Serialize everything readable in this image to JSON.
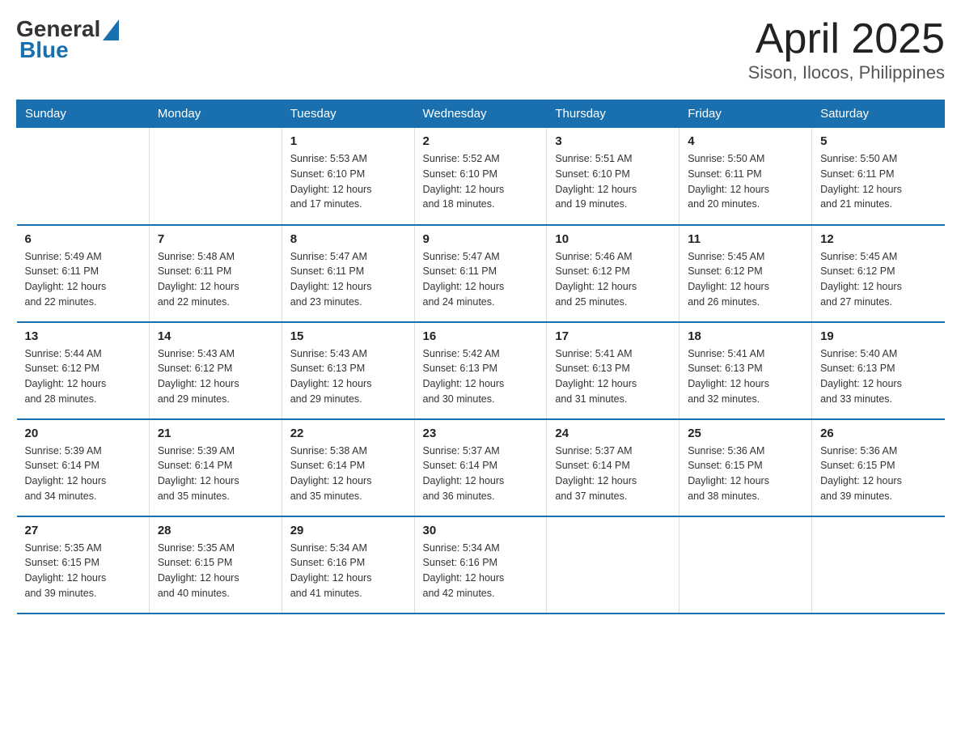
{
  "logo": {
    "general": "General",
    "blue": "Blue"
  },
  "title": "April 2025",
  "subtitle": "Sison, Ilocos, Philippines",
  "days_of_week": [
    "Sunday",
    "Monday",
    "Tuesday",
    "Wednesday",
    "Thursday",
    "Friday",
    "Saturday"
  ],
  "weeks": [
    [
      {
        "day": "",
        "info": ""
      },
      {
        "day": "",
        "info": ""
      },
      {
        "day": "1",
        "info": "Sunrise: 5:53 AM\nSunset: 6:10 PM\nDaylight: 12 hours\nand 17 minutes."
      },
      {
        "day": "2",
        "info": "Sunrise: 5:52 AM\nSunset: 6:10 PM\nDaylight: 12 hours\nand 18 minutes."
      },
      {
        "day": "3",
        "info": "Sunrise: 5:51 AM\nSunset: 6:10 PM\nDaylight: 12 hours\nand 19 minutes."
      },
      {
        "day": "4",
        "info": "Sunrise: 5:50 AM\nSunset: 6:11 PM\nDaylight: 12 hours\nand 20 minutes."
      },
      {
        "day": "5",
        "info": "Sunrise: 5:50 AM\nSunset: 6:11 PM\nDaylight: 12 hours\nand 21 minutes."
      }
    ],
    [
      {
        "day": "6",
        "info": "Sunrise: 5:49 AM\nSunset: 6:11 PM\nDaylight: 12 hours\nand 22 minutes."
      },
      {
        "day": "7",
        "info": "Sunrise: 5:48 AM\nSunset: 6:11 PM\nDaylight: 12 hours\nand 22 minutes."
      },
      {
        "day": "8",
        "info": "Sunrise: 5:47 AM\nSunset: 6:11 PM\nDaylight: 12 hours\nand 23 minutes."
      },
      {
        "day": "9",
        "info": "Sunrise: 5:47 AM\nSunset: 6:11 PM\nDaylight: 12 hours\nand 24 minutes."
      },
      {
        "day": "10",
        "info": "Sunrise: 5:46 AM\nSunset: 6:12 PM\nDaylight: 12 hours\nand 25 minutes."
      },
      {
        "day": "11",
        "info": "Sunrise: 5:45 AM\nSunset: 6:12 PM\nDaylight: 12 hours\nand 26 minutes."
      },
      {
        "day": "12",
        "info": "Sunrise: 5:45 AM\nSunset: 6:12 PM\nDaylight: 12 hours\nand 27 minutes."
      }
    ],
    [
      {
        "day": "13",
        "info": "Sunrise: 5:44 AM\nSunset: 6:12 PM\nDaylight: 12 hours\nand 28 minutes."
      },
      {
        "day": "14",
        "info": "Sunrise: 5:43 AM\nSunset: 6:12 PM\nDaylight: 12 hours\nand 29 minutes."
      },
      {
        "day": "15",
        "info": "Sunrise: 5:43 AM\nSunset: 6:13 PM\nDaylight: 12 hours\nand 29 minutes."
      },
      {
        "day": "16",
        "info": "Sunrise: 5:42 AM\nSunset: 6:13 PM\nDaylight: 12 hours\nand 30 minutes."
      },
      {
        "day": "17",
        "info": "Sunrise: 5:41 AM\nSunset: 6:13 PM\nDaylight: 12 hours\nand 31 minutes."
      },
      {
        "day": "18",
        "info": "Sunrise: 5:41 AM\nSunset: 6:13 PM\nDaylight: 12 hours\nand 32 minutes."
      },
      {
        "day": "19",
        "info": "Sunrise: 5:40 AM\nSunset: 6:13 PM\nDaylight: 12 hours\nand 33 minutes."
      }
    ],
    [
      {
        "day": "20",
        "info": "Sunrise: 5:39 AM\nSunset: 6:14 PM\nDaylight: 12 hours\nand 34 minutes."
      },
      {
        "day": "21",
        "info": "Sunrise: 5:39 AM\nSunset: 6:14 PM\nDaylight: 12 hours\nand 35 minutes."
      },
      {
        "day": "22",
        "info": "Sunrise: 5:38 AM\nSunset: 6:14 PM\nDaylight: 12 hours\nand 35 minutes."
      },
      {
        "day": "23",
        "info": "Sunrise: 5:37 AM\nSunset: 6:14 PM\nDaylight: 12 hours\nand 36 minutes."
      },
      {
        "day": "24",
        "info": "Sunrise: 5:37 AM\nSunset: 6:14 PM\nDaylight: 12 hours\nand 37 minutes."
      },
      {
        "day": "25",
        "info": "Sunrise: 5:36 AM\nSunset: 6:15 PM\nDaylight: 12 hours\nand 38 minutes."
      },
      {
        "day": "26",
        "info": "Sunrise: 5:36 AM\nSunset: 6:15 PM\nDaylight: 12 hours\nand 39 minutes."
      }
    ],
    [
      {
        "day": "27",
        "info": "Sunrise: 5:35 AM\nSunset: 6:15 PM\nDaylight: 12 hours\nand 39 minutes."
      },
      {
        "day": "28",
        "info": "Sunrise: 5:35 AM\nSunset: 6:15 PM\nDaylight: 12 hours\nand 40 minutes."
      },
      {
        "day": "29",
        "info": "Sunrise: 5:34 AM\nSunset: 6:16 PM\nDaylight: 12 hours\nand 41 minutes."
      },
      {
        "day": "30",
        "info": "Sunrise: 5:34 AM\nSunset: 6:16 PM\nDaylight: 12 hours\nand 42 minutes."
      },
      {
        "day": "",
        "info": ""
      },
      {
        "day": "",
        "info": ""
      },
      {
        "day": "",
        "info": ""
      }
    ]
  ]
}
